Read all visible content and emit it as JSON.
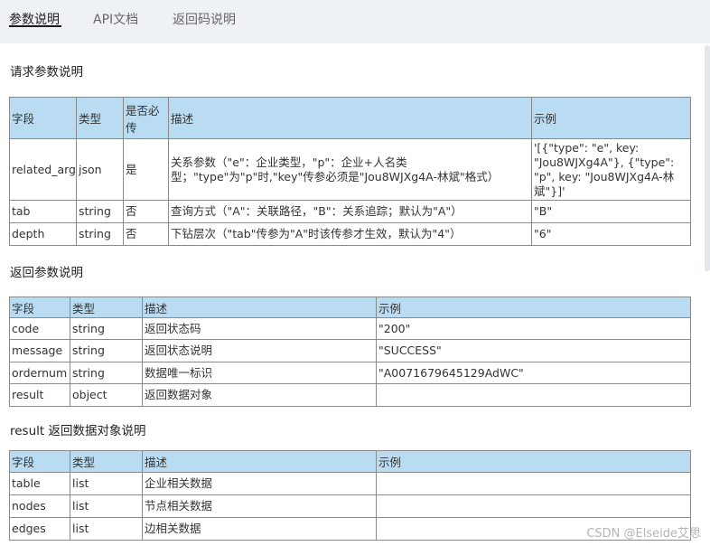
{
  "tabs": [
    {
      "label": "参数说明",
      "active": true
    },
    {
      "label": "API文档",
      "active": false
    },
    {
      "label": "返回码说明",
      "active": false
    }
  ],
  "request_section": {
    "title": "请求参数说明",
    "headers": [
      "字段",
      "类型",
      "是否必传",
      "描述",
      "示例"
    ],
    "rows": [
      [
        "related_args",
        "json",
        "是",
        "关系参数（\"e\"：企业类型，\"p\"：企业+人名类型；\"type\"为\"p\"时,\"key\"传参必须是\"Jou8WJXg4A-林斌\"格式）",
        "'[{\"type\": \"e\", key: \"Jou8WJXg4A\"}, {\"type\": \"p\", key: \"Jou8WJXg4A-林斌\"}]'"
      ],
      [
        "tab",
        "string",
        "否",
        "查询方式（\"A\"：关联路径，\"B\"：关系追踪；默认为\"A\"）",
        "\"B\""
      ],
      [
        "depth",
        "string",
        "否",
        "下钻层次（\"tab\"传参为\"A\"时该传参才生效，默认为\"4\"）",
        "\"6\""
      ]
    ]
  },
  "response_section": {
    "title": "返回参数说明",
    "headers": [
      "字段",
      "类型",
      "描述",
      "示例"
    ],
    "rows": [
      [
        "code",
        "string",
        "返回状态码",
        "\"200\""
      ],
      [
        "message",
        "string",
        "返回状态说明",
        "\"SUCCESS\""
      ],
      [
        "ordernum",
        "string",
        "数据唯一标识",
        "\"A0071679645129AdWC\""
      ],
      [
        "result",
        "object",
        "返回数据对象",
        ""
      ]
    ]
  },
  "result_section": {
    "title": "result 返回数据对象说明",
    "headers": [
      "字段",
      "类型",
      "描述",
      "示例"
    ],
    "rows": [
      [
        "table",
        "list",
        "企业相关数据",
        ""
      ],
      [
        "nodes",
        "list",
        "节点相关数据",
        ""
      ],
      [
        "edges",
        "list",
        "边相关数据",
        ""
      ]
    ]
  },
  "watermark": "CSDN @Elseide艾思"
}
